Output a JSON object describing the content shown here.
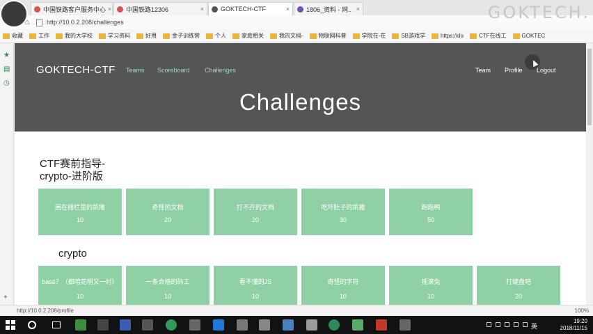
{
  "browser": {
    "tabs": [
      {
        "title": "中国铁路客户服务中心",
        "color": "#d9534f"
      },
      {
        "title": "中国铁路12306",
        "color": "#d9534f"
      },
      {
        "title": "GOKTECH-CTF",
        "color": "#555555"
      },
      {
        "title": "1806_资料 - 网..",
        "color": "#7a4fb5"
      }
    ],
    "watermark": "GOKTECH.",
    "url": "http://10.0.2.208/challenges",
    "bookmarks": [
      "收藏",
      "工作",
      "我的大学校",
      "学习资料",
      "好用",
      "金子训练营",
      "个人",
      "家庭相关",
      "我的文档-",
      "物联网科普",
      "学院在-在",
      "SB游戏学",
      "https://do",
      "CTF在线工",
      "GOKTEC"
    ],
    "status_url": "http://10.0.2.208/profile",
    "zoom": "100%"
  },
  "site": {
    "brand": "GOKTECH-CTF",
    "nav_left": [
      "Teams",
      "Scoreboard",
      "Challenges"
    ],
    "nav_right": [
      "Team",
      "Profile",
      "Logout"
    ],
    "hero_title": "Challenges"
  },
  "sections": [
    {
      "title_line1": "CTF赛前指导-",
      "title_line2": "crypto-进阶版",
      "challenges": [
        {
          "name": "困在栅栏里的凯撒",
          "points": "10"
        },
        {
          "name": "奇怪的文档",
          "points": "20"
        },
        {
          "name": "打不开的文档",
          "points": "20"
        },
        {
          "name": "吃坏肚子的凯撒",
          "points": "30"
        },
        {
          "name": "跑跑鸭",
          "points": "50"
        }
      ]
    },
    {
      "title_line1": "crypto",
      "challenges": [
        {
          "name": "base？（都暗花明又一村）",
          "points": "10"
        },
        {
          "name": "一条合格的码工",
          "points": "10"
        },
        {
          "name": "看不懂的JS",
          "points": "10"
        },
        {
          "name": "奇怪的字符",
          "points": "10"
        },
        {
          "name": "摇滚兔",
          "points": "10"
        },
        {
          "name": "打键盘吧",
          "points": "20"
        }
      ]
    }
  ],
  "taskbar": {
    "language": "英",
    "time": "19:20",
    "date": "2018/11/15"
  },
  "colors": {
    "hero_bg": "#555555",
    "card_bg": "#8fd0a5",
    "nav_accent": "#9fd9b4"
  }
}
